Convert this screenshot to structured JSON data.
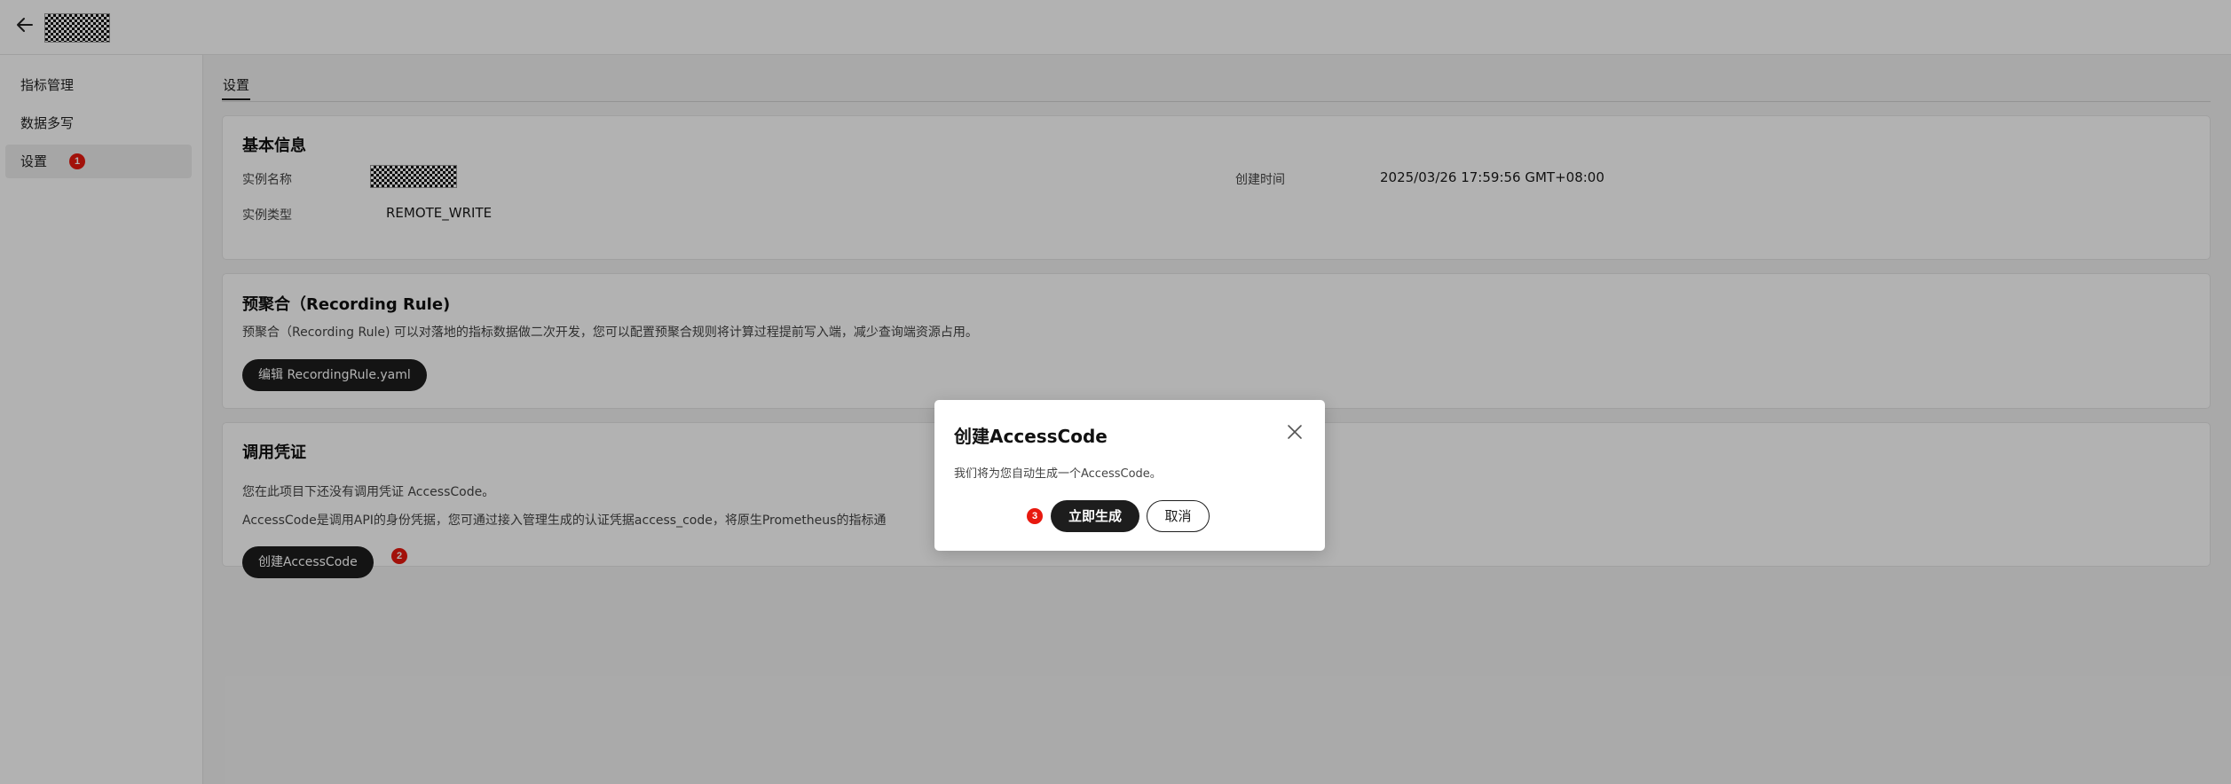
{
  "header": {
    "back_icon": "arrow-left-icon",
    "logo": "redacted-logo"
  },
  "sidebar": {
    "items": [
      {
        "label": "指标管理"
      },
      {
        "label": "数据多写"
      },
      {
        "label": "设置",
        "badge": "1",
        "active": true
      }
    ]
  },
  "main": {
    "tabs": [
      {
        "label": "设置"
      }
    ],
    "basic_info": {
      "title": "基本信息",
      "instance_name_label": "实例名称",
      "instance_type_label": "实例类型",
      "instance_type_value": "REMOTE_WRITE",
      "created_time_label": "创建时间",
      "created_time_value": "2025/03/26 17:59:56 GMT+08:00"
    },
    "recording_rule": {
      "title": "预聚合（Recording Rule)",
      "description": "预聚合（Recording Rule) 可以对落地的指标数据做二次开发，您可以配置预聚合规则将计算过程提前写入端，减少查询端资源占用。",
      "edit_button": "编辑 RecordingRule.yaml"
    },
    "credentials": {
      "title": "调用凭证",
      "line1": "您在此项目下还没有调用凭证 AccessCode。",
      "line2": "AccessCode是调用API的身份凭据，您可通过接入管理生成的认证凭据access_code，将原生Prometheus的指标通",
      "create_button": "创建AccessCode",
      "badge": "2"
    }
  },
  "dialog": {
    "title": "创建AccessCode",
    "message": "我们将为您自动生成一个AccessCode。",
    "confirm_label": "立即生成",
    "cancel_label": "取消",
    "badge": "3"
  },
  "colors": {
    "badge_red": "#e8190f",
    "primary_dark": "#1d1d1d",
    "overlay": "rgba(0,0,0,0.30)"
  }
}
